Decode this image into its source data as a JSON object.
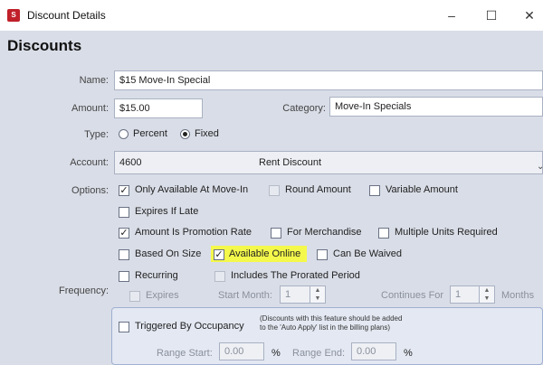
{
  "window": {
    "title": "Discount Details",
    "minimize": "–",
    "maximize": "☐",
    "close": "✕"
  },
  "heading": "Discounts",
  "labels": {
    "name": "Name:",
    "amount": "Amount:",
    "category": "Category:",
    "type": "Type:",
    "account": "Account:",
    "options": "Options:",
    "frequency": "Frequency:"
  },
  "fields": {
    "name": "$15 Move-In Special",
    "amount": "$15.00",
    "category": "Move-In Specials",
    "account_number": "4600",
    "account_name": "Rent Discount"
  },
  "type_options": {
    "percent": "Percent",
    "fixed": "Fixed",
    "selected": "Fixed"
  },
  "options": {
    "only_move_in": {
      "label": "Only Available At Move-In",
      "checked": true
    },
    "round_amount": {
      "label": "Round Amount",
      "checked": false
    },
    "variable_amount": {
      "label": "Variable Amount",
      "checked": false
    },
    "expires_if_late": {
      "label": "Expires If Late",
      "checked": false
    },
    "promotion_rate": {
      "label": "Amount Is Promotion Rate",
      "checked": true
    },
    "for_merchandise": {
      "label": "For Merchandise",
      "checked": false
    },
    "multiple_units": {
      "label": "Multiple Units Required",
      "checked": false
    },
    "based_on_size": {
      "label": "Based On Size",
      "checked": false
    },
    "available_online": {
      "label": "Available Online",
      "checked": true
    },
    "can_be_waived": {
      "label": "Can Be Waived",
      "checked": false
    }
  },
  "frequency": {
    "recurring": "Recurring",
    "includes_prorated": "Includes The Prorated Period",
    "expires": "Expires",
    "start_month_label": "Start Month:",
    "start_month_value": "1",
    "continues_for_label": "Continues For",
    "continues_for_value": "1",
    "months_label": "Months"
  },
  "occupancy": {
    "label": "Triggered By Occupancy",
    "note_line1": "(Discounts with this feature should be added",
    "note_line2": "to the 'Auto Apply' list in the billing plans)",
    "range_start_label": "Range Start:",
    "range_start_value": "0.00",
    "range_end_label": "Range End:",
    "range_end_value": "0.00",
    "percent_sign": "%"
  },
  "colors": {
    "panel": "#d9dde7",
    "highlight": "#f4f84a",
    "app_icon": "#c0202a"
  }
}
